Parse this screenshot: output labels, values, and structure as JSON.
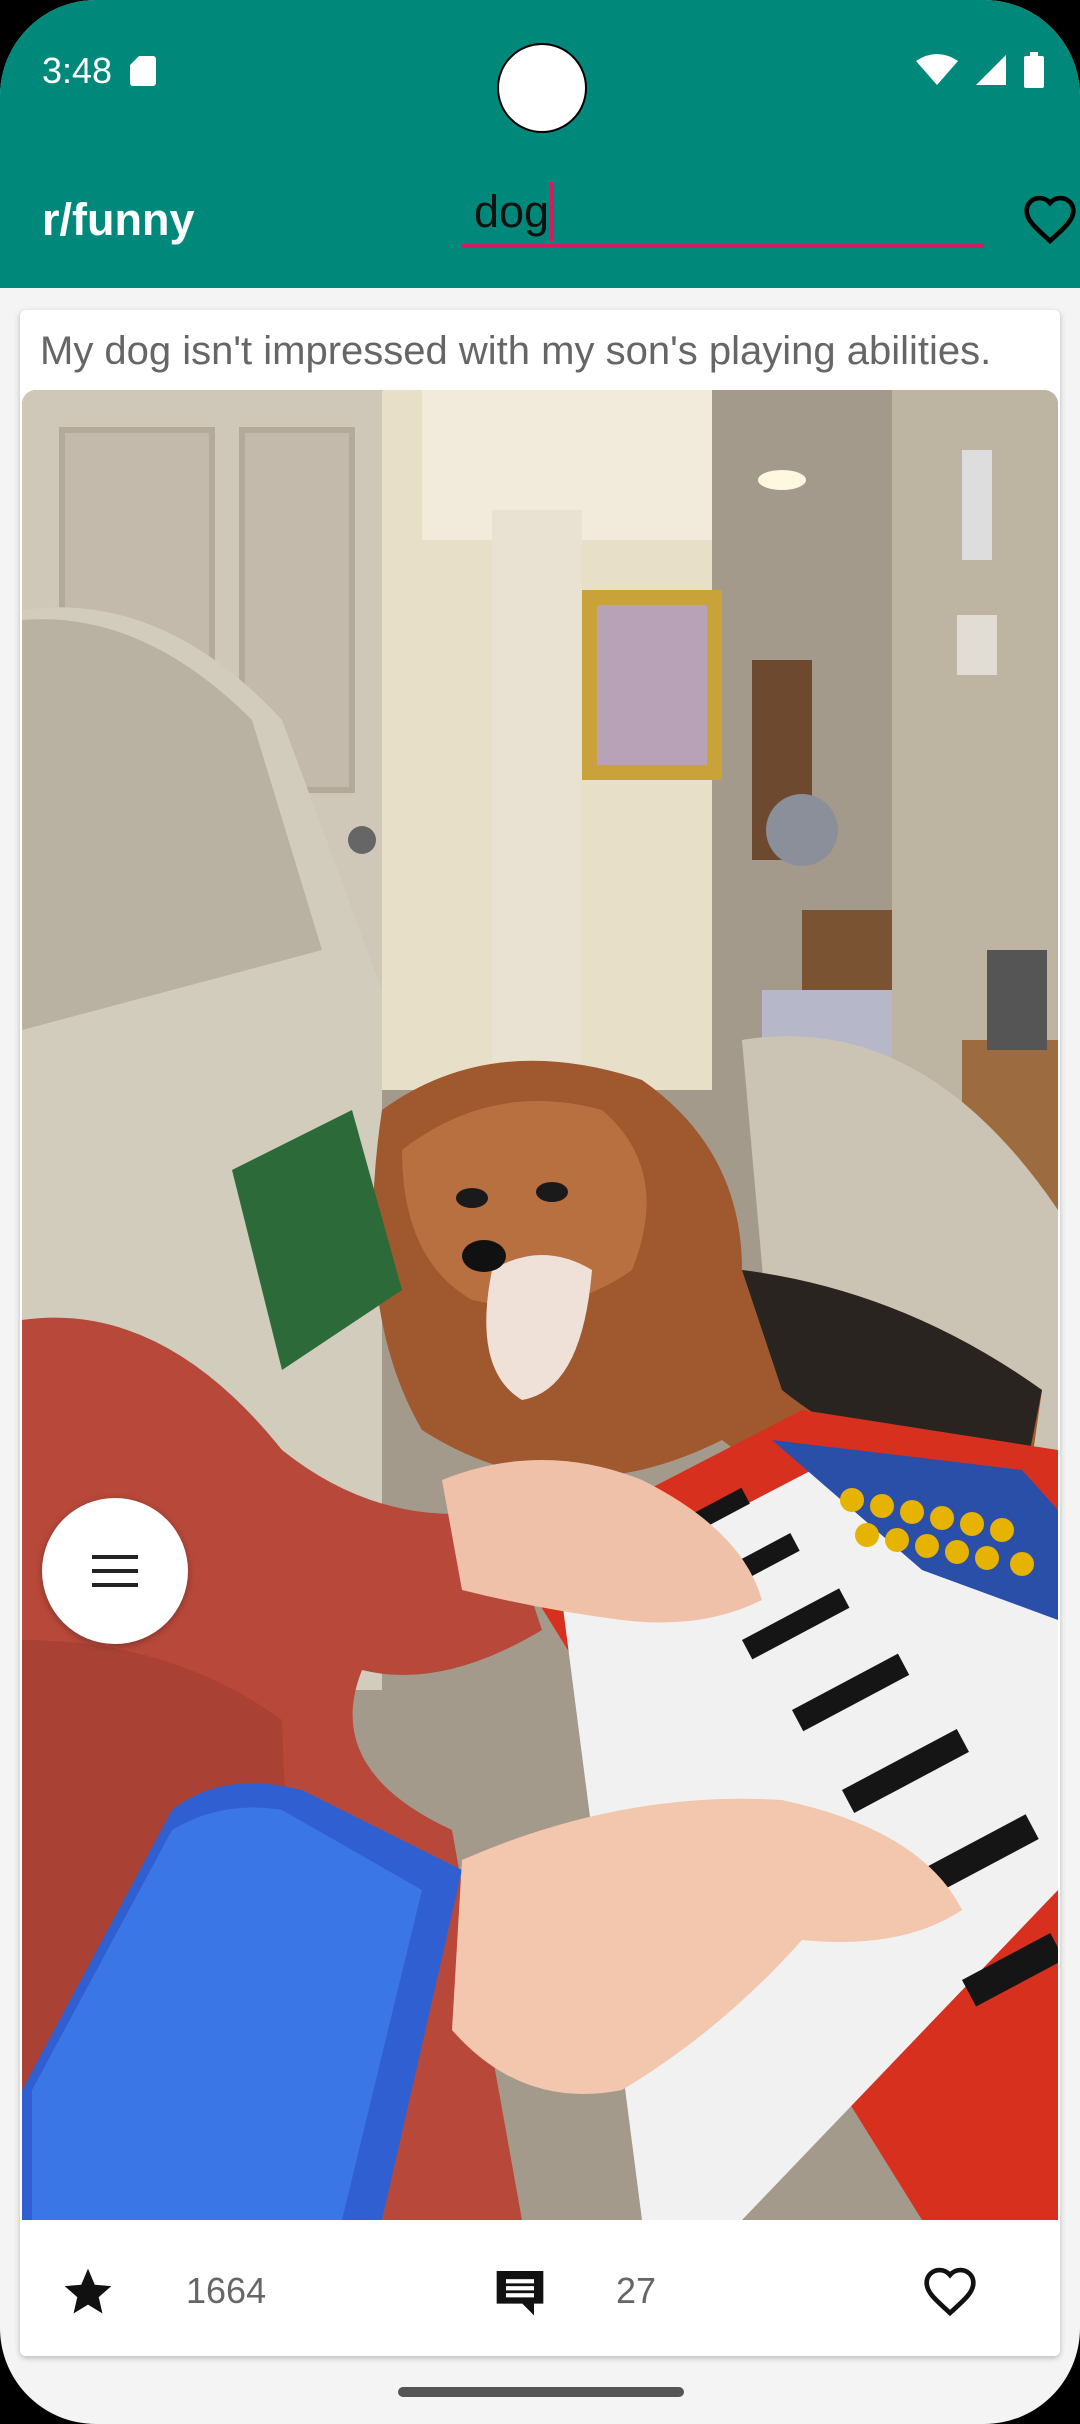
{
  "status_bar": {
    "time": "3:48",
    "icons": [
      "sd-card-icon",
      "wifi-icon",
      "signal-icon",
      "battery-icon"
    ]
  },
  "app_bar": {
    "title": "r/funny",
    "search": {
      "value": "dog",
      "placeholder": ""
    }
  },
  "post": {
    "title": "My dog isn't impressed with my son's playing abilities.",
    "score": "1664",
    "comments": "27"
  },
  "colors": {
    "accent": "#00897b",
    "cursor": "#d81b60"
  }
}
